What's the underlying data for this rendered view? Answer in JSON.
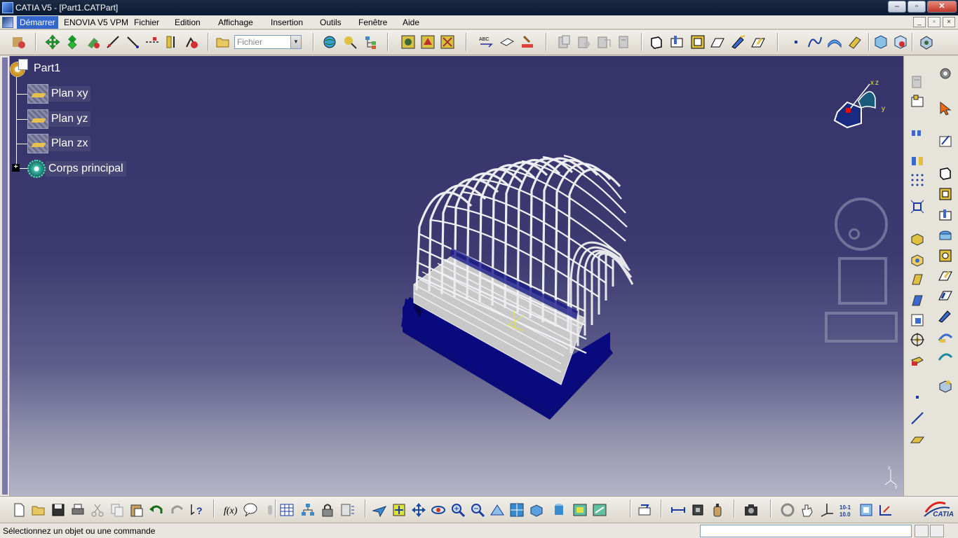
{
  "window": {
    "title": "CATIA V5 - [Part1.CATPart]",
    "min_label": "–",
    "max_label": "▫",
    "close_label": "✕"
  },
  "menu": {
    "items": [
      "Démarrer",
      "ENOVIA V5 VPM",
      "Fichier",
      "Edition",
      "Affichage",
      "Insertion",
      "Outils",
      "Fenêtre",
      "Aide"
    ]
  },
  "toolbar": {
    "file_combo_value": "Fichier"
  },
  "tree": {
    "root": "Part1",
    "items": [
      "Plan xy",
      "Plan yz",
      "Plan zx",
      "Corps principal"
    ]
  },
  "compass": {
    "label_x": "x",
    "label_z": "z",
    "label_y": "y"
  },
  "status": {
    "message": "Sélectionnez un objet ou une commande",
    "command_value": ""
  },
  "logo": {
    "text": "CATIA",
    "brand_color": "#1a3a8a"
  },
  "colors": {
    "viewport_top": "#35336a",
    "viewport_bottom": "#b4b4c8",
    "cage_base": "#0a0a78",
    "cage_wire": "#e8e8ea"
  }
}
